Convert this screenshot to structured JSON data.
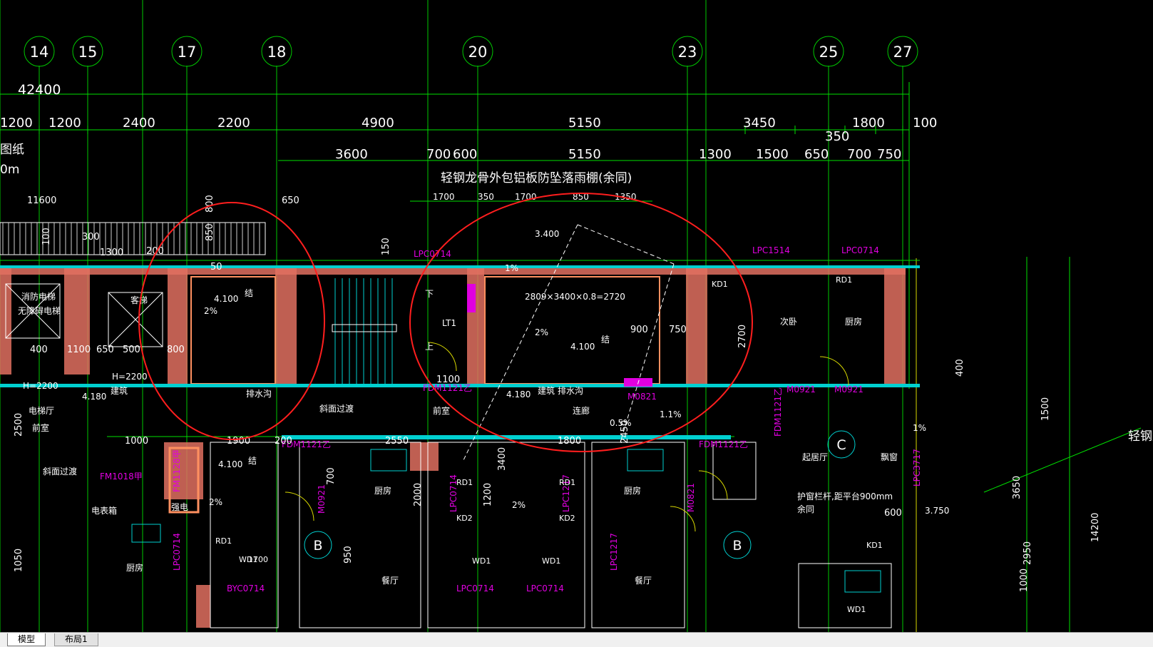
{
  "tabs": [
    {
      "label": "模型",
      "active": true
    },
    {
      "label": "布局1",
      "active": false
    }
  ],
  "colors": {
    "background": "#000000",
    "axis": "#00c800",
    "dimension": "#00e000",
    "wall": "#e07060",
    "wall_edge": "#ff9060",
    "annotation": "#ffffff",
    "tag": "#e000e0",
    "cyan": "#00d0d0",
    "yellow": "#d8d800",
    "red_markup": "#ff1e1e"
  },
  "drawing": {
    "axis_labels": [
      "14",
      "15",
      "17",
      "18",
      "20",
      "23",
      "25",
      "27"
    ],
    "overall_dimension": "42400",
    "dim_row1": [
      "1200",
      "1200",
      "2400",
      "2200",
      "4900",
      "5150",
      "3450",
      "1800",
      "100"
    ],
    "dim_row2": [
      "3600",
      "700",
      "600",
      "5150",
      "1300",
      "1500",
      "650",
      "700",
      "750",
      "350"
    ],
    "canopy_note": "轻钢龙骨外包铝板防坠落雨棚(余同)",
    "canopy_dims": [
      "1700",
      "350",
      "1700",
      "850",
      "1350"
    ],
    "left_note_1": "图纸",
    "left_note_2": "0m",
    "dims_misc": [
      "11600",
      "650",
      "800",
      "850",
      "300",
      "100",
      "200",
      "150",
      "1300",
      "50",
      "400",
      "1100",
      "650",
      "500",
      "800",
      "2700",
      "900",
      "750",
      "1100",
      "1000",
      "1900",
      "200",
      "2550",
      "1800",
      "2450",
      "3400",
      "1200",
      "2000",
      "950",
      "700",
      "2500",
      "1050",
      "400",
      "3650",
      "2950",
      "14200",
      "1500",
      "600",
      "1000"
    ],
    "room_labels": [
      "消防电梯",
      "无障碍电梯",
      "客梯",
      "电梯厅",
      "前室",
      "前室",
      "连廊",
      "次卧",
      "厨房",
      "起居厅",
      "厨房",
      "厨房",
      "餐厅",
      "餐厅",
      "厨房",
      "强电",
      "电表箱",
      "飘窗",
      "斜面过渡",
      "斜面过渡"
    ],
    "annotations": [
      "4.100",
      "结",
      "2%",
      "4.180",
      "建筑",
      "H=2200",
      "H=2200",
      "LT1",
      "下",
      "上",
      "3.400",
      "1%",
      "2809×3400×0.8=2720",
      "2%",
      "4.100",
      "结",
      "4.180",
      "建筑",
      "排水沟",
      "排水沟",
      "4.100",
      "结",
      "2%",
      "3.750",
      "护窗栏杆,距平台900mm",
      "余同",
      "1%",
      "0.5%",
      "1.1%",
      "2%"
    ],
    "tags": [
      "LPC0714",
      "LPC1514",
      "LPC0714",
      "FDM1121乙",
      "FDM1121乙",
      "FDM1121乙",
      "FDM1121乙",
      "FM1018甲",
      "FM1128甲",
      "M0921",
      "M0921",
      "M0921",
      "M0821",
      "M0821",
      "BYC0714",
      "LPC0714",
      "LPC0714",
      "LPC0714",
      "LPC1217",
      "LPC1217",
      "LPC3717",
      "LPC0714"
    ],
    "misc_labels": [
      "RD1",
      "RD1",
      "RD1",
      "RD1",
      "KD1",
      "KD1",
      "KD2",
      "KD2",
      "WD1",
      "WD1",
      "WD1",
      "WD1",
      "1700"
    ],
    "grid_letters": [
      "B",
      "B",
      "C"
    ],
    "right_note": "轻钢龙"
  }
}
